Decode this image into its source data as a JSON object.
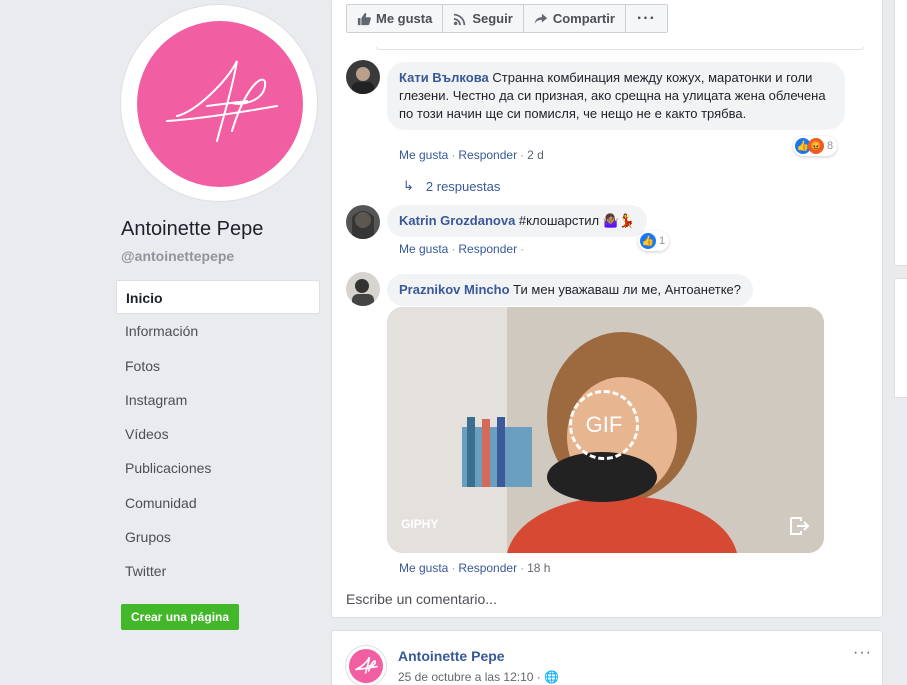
{
  "colors": {
    "brand_pink": "#f25ea2",
    "link_blue": "#385898",
    "create_green": "#42b72a"
  },
  "profile": {
    "name": "Antoinette Pepe",
    "handle": "@antoinettepepe",
    "logo_initials": "AP"
  },
  "nav": {
    "items": [
      {
        "label": "Inicio",
        "active": true
      },
      {
        "label": "Información"
      },
      {
        "label": "Fotos"
      },
      {
        "label": "Instagram"
      },
      {
        "label": "Vídeos"
      },
      {
        "label": "Publicaciones"
      },
      {
        "label": "Comunidad"
      },
      {
        "label": "Grupos"
      },
      {
        "label": "Twitter"
      }
    ],
    "create_page": "Crear una página"
  },
  "action_bar": {
    "like": "Me gusta",
    "follow": "Seguir",
    "share": "Compartir",
    "more": "···"
  },
  "comments": [
    {
      "author": "Кати Вълкова",
      "text": "Странна комбинация между кожух, маратонки и голи глезени. Честно да си призная, ако срещна на улицата жена облечена по този начин ще си помисля, че нещо не е както трябва.",
      "like": "Me gusta",
      "reply": "Responder",
      "time": "2 d",
      "reaction_count": "8",
      "replies_label": "2 respuestas"
    },
    {
      "author": "Katrin Grozdanova",
      "text": "#клошарстил 🤷🏽‍♀️💃",
      "like": "Me gusta",
      "reply": "Responder",
      "reaction_count": "1"
    },
    {
      "author": "Praznikov Mincho",
      "text": "Ти мен уважаваш ли ме, Антоанетке?",
      "like": "Me gusta",
      "reply": "Responder",
      "time": "18 h",
      "gif": {
        "badge": "GIF",
        "source": "GIPHY"
      }
    }
  ],
  "write_comment": "Escribe un comentario...",
  "post2": {
    "author": "Antoinette Pepe",
    "time": "25 de octubre a las 12:10 ·",
    "more": "···"
  }
}
